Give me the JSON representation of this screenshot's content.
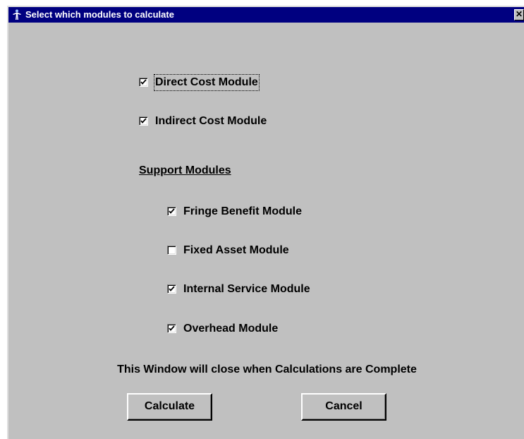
{
  "window": {
    "title": "Select which modules to calculate",
    "close_label": "✕"
  },
  "modules": {
    "direct_cost": {
      "label": "Direct Cost Module",
      "checked": true
    },
    "indirect_cost": {
      "label": "Indirect Cost Module",
      "checked": true
    }
  },
  "support": {
    "heading": "Support Modules",
    "items": [
      {
        "label": "Fringe Benefit Module",
        "checked": true
      },
      {
        "label": "Fixed Asset Module",
        "checked": false
      },
      {
        "label": "Internal Service Module",
        "checked": true
      },
      {
        "label": "Overhead Module",
        "checked": true
      }
    ]
  },
  "message": "This Window will close when Calculations are Complete",
  "buttons": {
    "calculate": "Calculate",
    "cancel": "Cancel"
  },
  "colors": {
    "titlebar": "#000080",
    "face": "#c0c0c0"
  },
  "icons": {
    "title": "app-figure-icon",
    "check": "checkmark-icon"
  }
}
